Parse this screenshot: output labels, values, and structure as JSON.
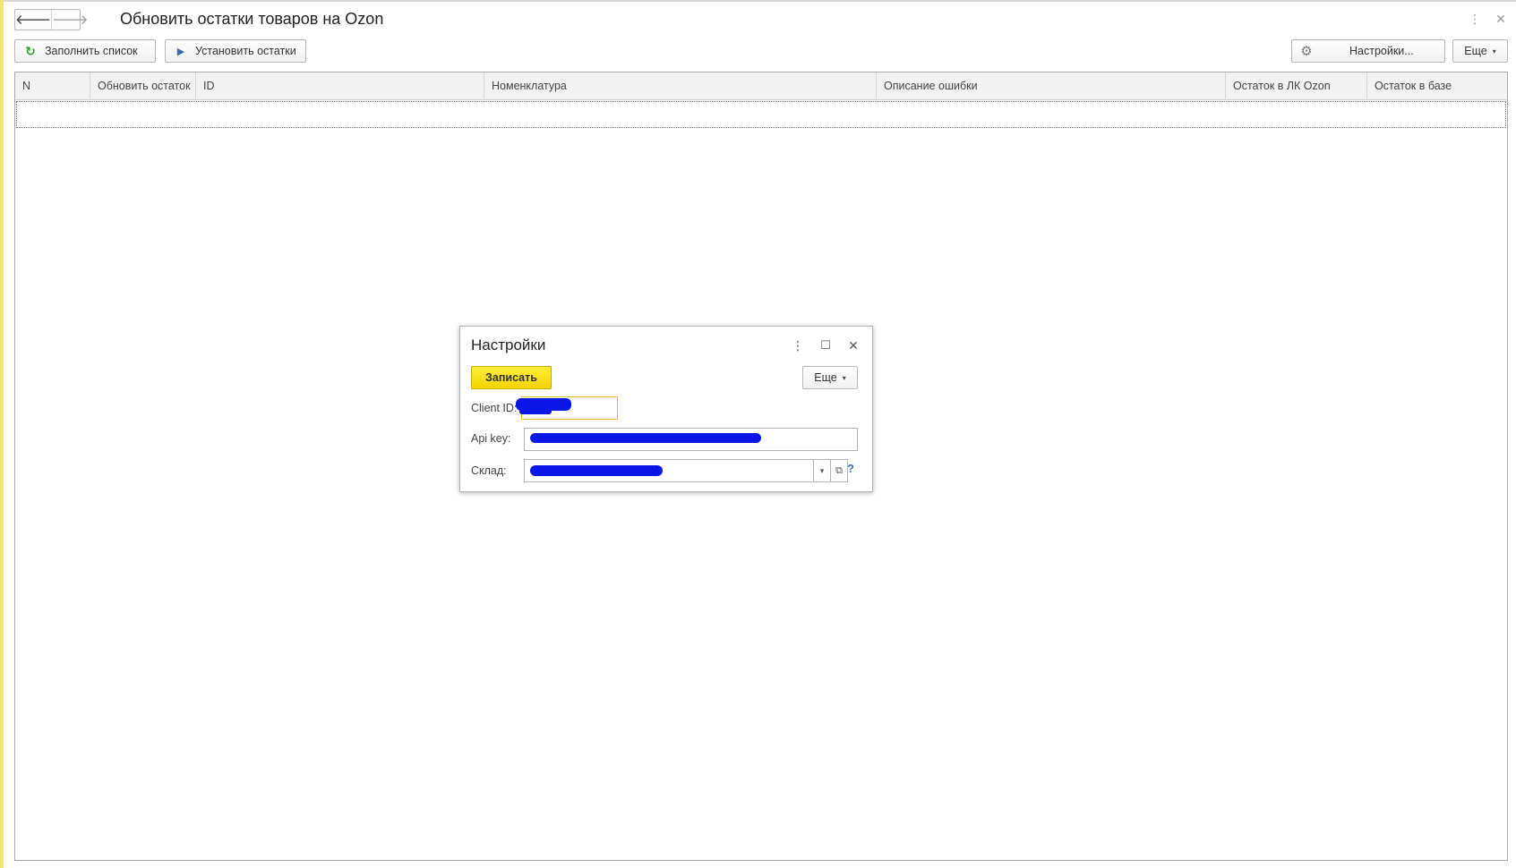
{
  "window": {
    "title": "Обновить остатки товаров на Ozon",
    "kebab_glyph": "⋮",
    "close_glyph": "✕"
  },
  "nav": {
    "back_glyph": "🡐",
    "forward_glyph": "🡒"
  },
  "toolbar": {
    "fill_list_label": "Заполнить список",
    "fill_list_icon": "refresh-icon",
    "set_stock_label": "Установить остатки",
    "set_stock_icon": "play-arrow-icon",
    "settings_label": "Настройки...",
    "settings_icon": "gear-icon",
    "more_label": "Еще",
    "caret_glyph": "▾"
  },
  "table": {
    "columns": [
      "N",
      "Обновить остаток",
      "ID",
      "Номенклатура",
      "Описание ошибки",
      "Остаток в ЛК Ozon",
      "Остаток в базе"
    ],
    "rows": []
  },
  "dialog": {
    "title": "Настройки",
    "kebab_glyph": "⋮",
    "maximize_glyph": "☐",
    "close_glyph": "✕",
    "save_label": "Записать",
    "more_label": "Еще",
    "caret_glyph": "▾",
    "client_id_label": "Client ID:",
    "api_key_label": "Api key:",
    "warehouse_label": "Склад:",
    "open_glyph": "⧉",
    "help_glyph": "?",
    "accent_color": "#f5d400",
    "redaction_color": "#0a16e6"
  }
}
